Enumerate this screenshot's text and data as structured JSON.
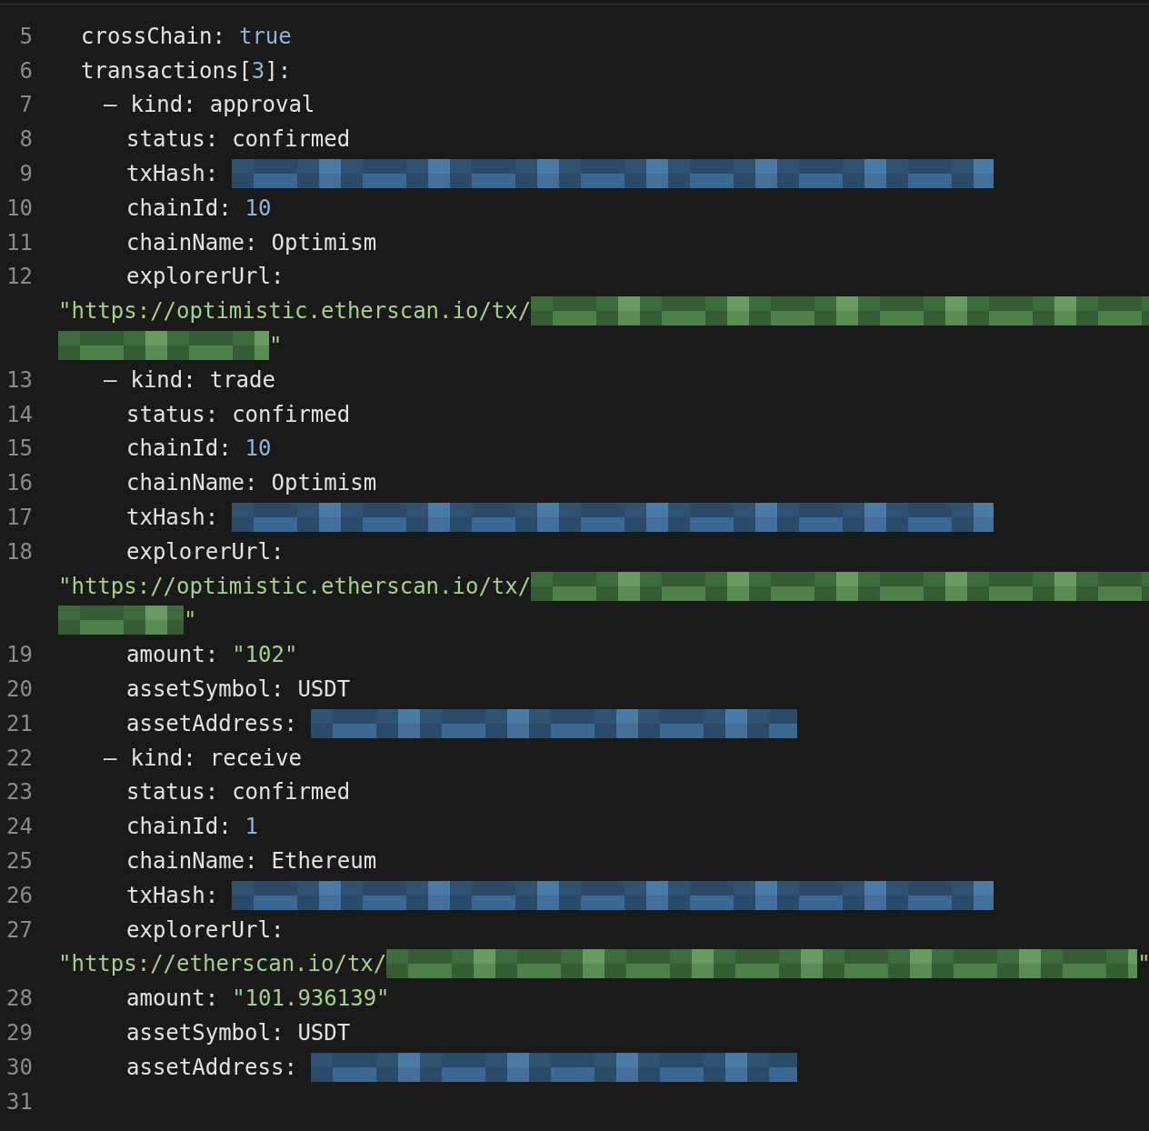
{
  "editor": {
    "lines": [
      {
        "number": "5",
        "segments": [
          {
            "kind": "text",
            "text": "crossChain:"
          },
          {
            "kind": "number",
            "text": "true"
          }
        ]
      },
      {
        "number": "6",
        "segments": [
          {
            "kind": "text",
            "text": "transactions[",
            "after": [
              {
                "kind": "number",
                "text": "3"
              },
              {
                "kind": "text",
                "text": "]:"
              }
            ]
          }
        ],
        "children": [
          {
            "number": "7",
            "dash": "–",
            "segments": [
              {
                "kind": "text",
                "text": "kind:"
              },
              {
                "kind": "text",
                "text": "approval"
              }
            ],
            "children": [
              {
                "number": "8",
                "segments": [
                  {
                    "kind": "text",
                    "text": "status:"
                  },
                  {
                    "kind": "text",
                    "text": "confirmed"
                  }
                ]
              },
              {
                "number": "9",
                "segments": [
                  {
                    "kind": "text",
                    "text": "txHash:"
                  },
                  {
                    "kind": "mask-hash"
                  }
                ]
              },
              {
                "number": "10",
                "segments": [
                  {
                    "kind": "text",
                    "text": "chainId:"
                  },
                  {
                    "kind": "number",
                    "text": "10"
                  }
                ]
              },
              {
                "number": "11",
                "segments": [
                  {
                    "kind": "text",
                    "text": "chainName:"
                  },
                  {
                    "kind": "text",
                    "text": "Optimism"
                  }
                ]
              },
              {
                "number": "12",
                "segments": [
                  {
                    "kind": "text",
                    "text": "explorerUrl:"
                  }
                ],
                "wrap": [
                  [
                    {
                      "kind": "string",
                      "text": "\"https://optimistic.etherscan.io/tx/"
                    },
                    {
                      "kind": "mask-url-head"
                    }
                  ],
                  [
                    {
                      "kind": "mask-url-tail-long"
                    },
                    {
                      "kind": "string",
                      "text": "\""
                    }
                  ]
                ]
              }
            ]
          },
          {
            "number": "13",
            "dash": "–",
            "segments": [
              {
                "kind": "text",
                "text": "kind:"
              },
              {
                "kind": "text",
                "text": "trade"
              }
            ],
            "children": [
              {
                "number": "14",
                "segments": [
                  {
                    "kind": "text",
                    "text": "status:"
                  },
                  {
                    "kind": "text",
                    "text": "confirmed"
                  }
                ]
              },
              {
                "number": "15",
                "segments": [
                  {
                    "kind": "text",
                    "text": "chainId:"
                  },
                  {
                    "kind": "number",
                    "text": "10"
                  }
                ]
              },
              {
                "number": "16",
                "segments": [
                  {
                    "kind": "text",
                    "text": "chainName:"
                  },
                  {
                    "kind": "text",
                    "text": "Optimism"
                  }
                ]
              },
              {
                "number": "17",
                "segments": [
                  {
                    "kind": "text",
                    "text": "txHash:"
                  },
                  {
                    "kind": "mask-hash"
                  }
                ]
              },
              {
                "number": "18",
                "segments": [
                  {
                    "kind": "text",
                    "text": "explorerUrl:"
                  }
                ],
                "wrap": [
                  [
                    {
                      "kind": "string",
                      "text": "\"https://optimistic.etherscan.io/tx/"
                    },
                    {
                      "kind": "mask-url-head"
                    }
                  ],
                  [
                    {
                      "kind": "mask-url-tail-short"
                    },
                    {
                      "kind": "string",
                      "text": "\""
                    }
                  ]
                ]
              },
              {
                "number": "19",
                "segments": [
                  {
                    "kind": "text",
                    "text": "amount:"
                  },
                  {
                    "kind": "string",
                    "text": "\"102\""
                  }
                ]
              },
              {
                "number": "20",
                "segments": [
                  {
                    "kind": "text",
                    "text": "assetSymbol:"
                  },
                  {
                    "kind": "text",
                    "text": "USDT"
                  }
                ]
              },
              {
                "number": "21",
                "segments": [
                  {
                    "kind": "text",
                    "text": "assetAddress:"
                  },
                  {
                    "kind": "mask-address"
                  }
                ]
              }
            ]
          },
          {
            "number": "22",
            "dash": "–",
            "segments": [
              {
                "kind": "text",
                "text": "kind:"
              },
              {
                "kind": "text",
                "text": "receive"
              }
            ],
            "children": [
              {
                "number": "23",
                "segments": [
                  {
                    "kind": "text",
                    "text": "status:"
                  },
                  {
                    "kind": "text",
                    "text": "confirmed"
                  }
                ]
              },
              {
                "number": "24",
                "segments": [
                  {
                    "kind": "text",
                    "text": "chainId:"
                  },
                  {
                    "kind": "number",
                    "text": "1"
                  }
                ]
              },
              {
                "number": "25",
                "segments": [
                  {
                    "kind": "text",
                    "text": "chainName:"
                  },
                  {
                    "kind": "text",
                    "text": "Ethereum"
                  }
                ]
              },
              {
                "number": "26",
                "segments": [
                  {
                    "kind": "text",
                    "text": "txHash:"
                  },
                  {
                    "kind": "mask-hash"
                  }
                ]
              },
              {
                "number": "27",
                "segments": [
                  {
                    "kind": "text",
                    "text": "explorerUrl:"
                  }
                ],
                "wrap": [
                  [
                    {
                      "kind": "string",
                      "text": "\"https://etherscan.io/tx/"
                    },
                    {
                      "kind": "mask-url-full"
                    },
                    {
                      "kind": "string",
                      "text": "\""
                    }
                  ]
                ]
              },
              {
                "number": "28",
                "segments": [
                  {
                    "kind": "text",
                    "text": "amount:"
                  },
                  {
                    "kind": "string",
                    "text": "\"101.936139\""
                  }
                ]
              },
              {
                "number": "29",
                "segments": [
                  {
                    "kind": "text",
                    "text": "assetSymbol:"
                  },
                  {
                    "kind": "text",
                    "text": "USDT"
                  }
                ]
              },
              {
                "number": "30",
                "segments": [
                  {
                    "kind": "text",
                    "text": "assetAddress:"
                  },
                  {
                    "kind": "mask-address"
                  }
                ]
              }
            ]
          }
        ]
      },
      {
        "number": "31"
      }
    ]
  }
}
